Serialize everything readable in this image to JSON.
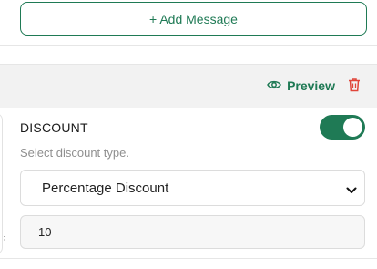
{
  "add_message": {
    "label": "+ Add Message"
  },
  "section_header": {
    "preview_label": "Preview"
  },
  "discount": {
    "title": "DISCOUNT",
    "enabled": true,
    "helper_text": "Select discount type.",
    "type_selected": "Percentage Discount",
    "value": "10"
  },
  "colors": {
    "accent": "#1f7a55",
    "danger": "#e0453a"
  },
  "icons": {
    "preview": "eye-icon",
    "delete": "trash-icon",
    "dropdown": "chevron-down-icon"
  }
}
